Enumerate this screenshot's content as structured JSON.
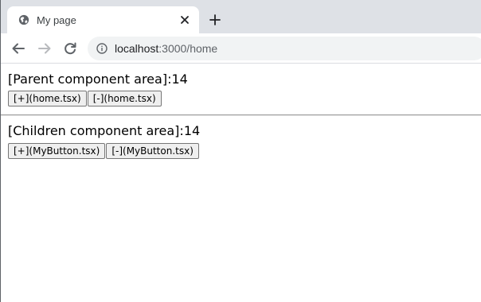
{
  "browser": {
    "tab": {
      "title": "My page",
      "favicon": "globe-icon"
    },
    "url": {
      "host": "localhost",
      "rest": ":3000/home"
    }
  },
  "page": {
    "parent": {
      "label": "[Parent component area]:",
      "count": "14",
      "buttons": [
        {
          "label": "[+](home.tsx)"
        },
        {
          "label": "[-](home.tsx)"
        }
      ]
    },
    "children": {
      "label": "[Children component area]:",
      "count": "14",
      "buttons": [
        {
          "label": "[+](MyButton.tsx)"
        },
        {
          "label": "[-](MyButton.tsx)"
        }
      ]
    }
  }
}
